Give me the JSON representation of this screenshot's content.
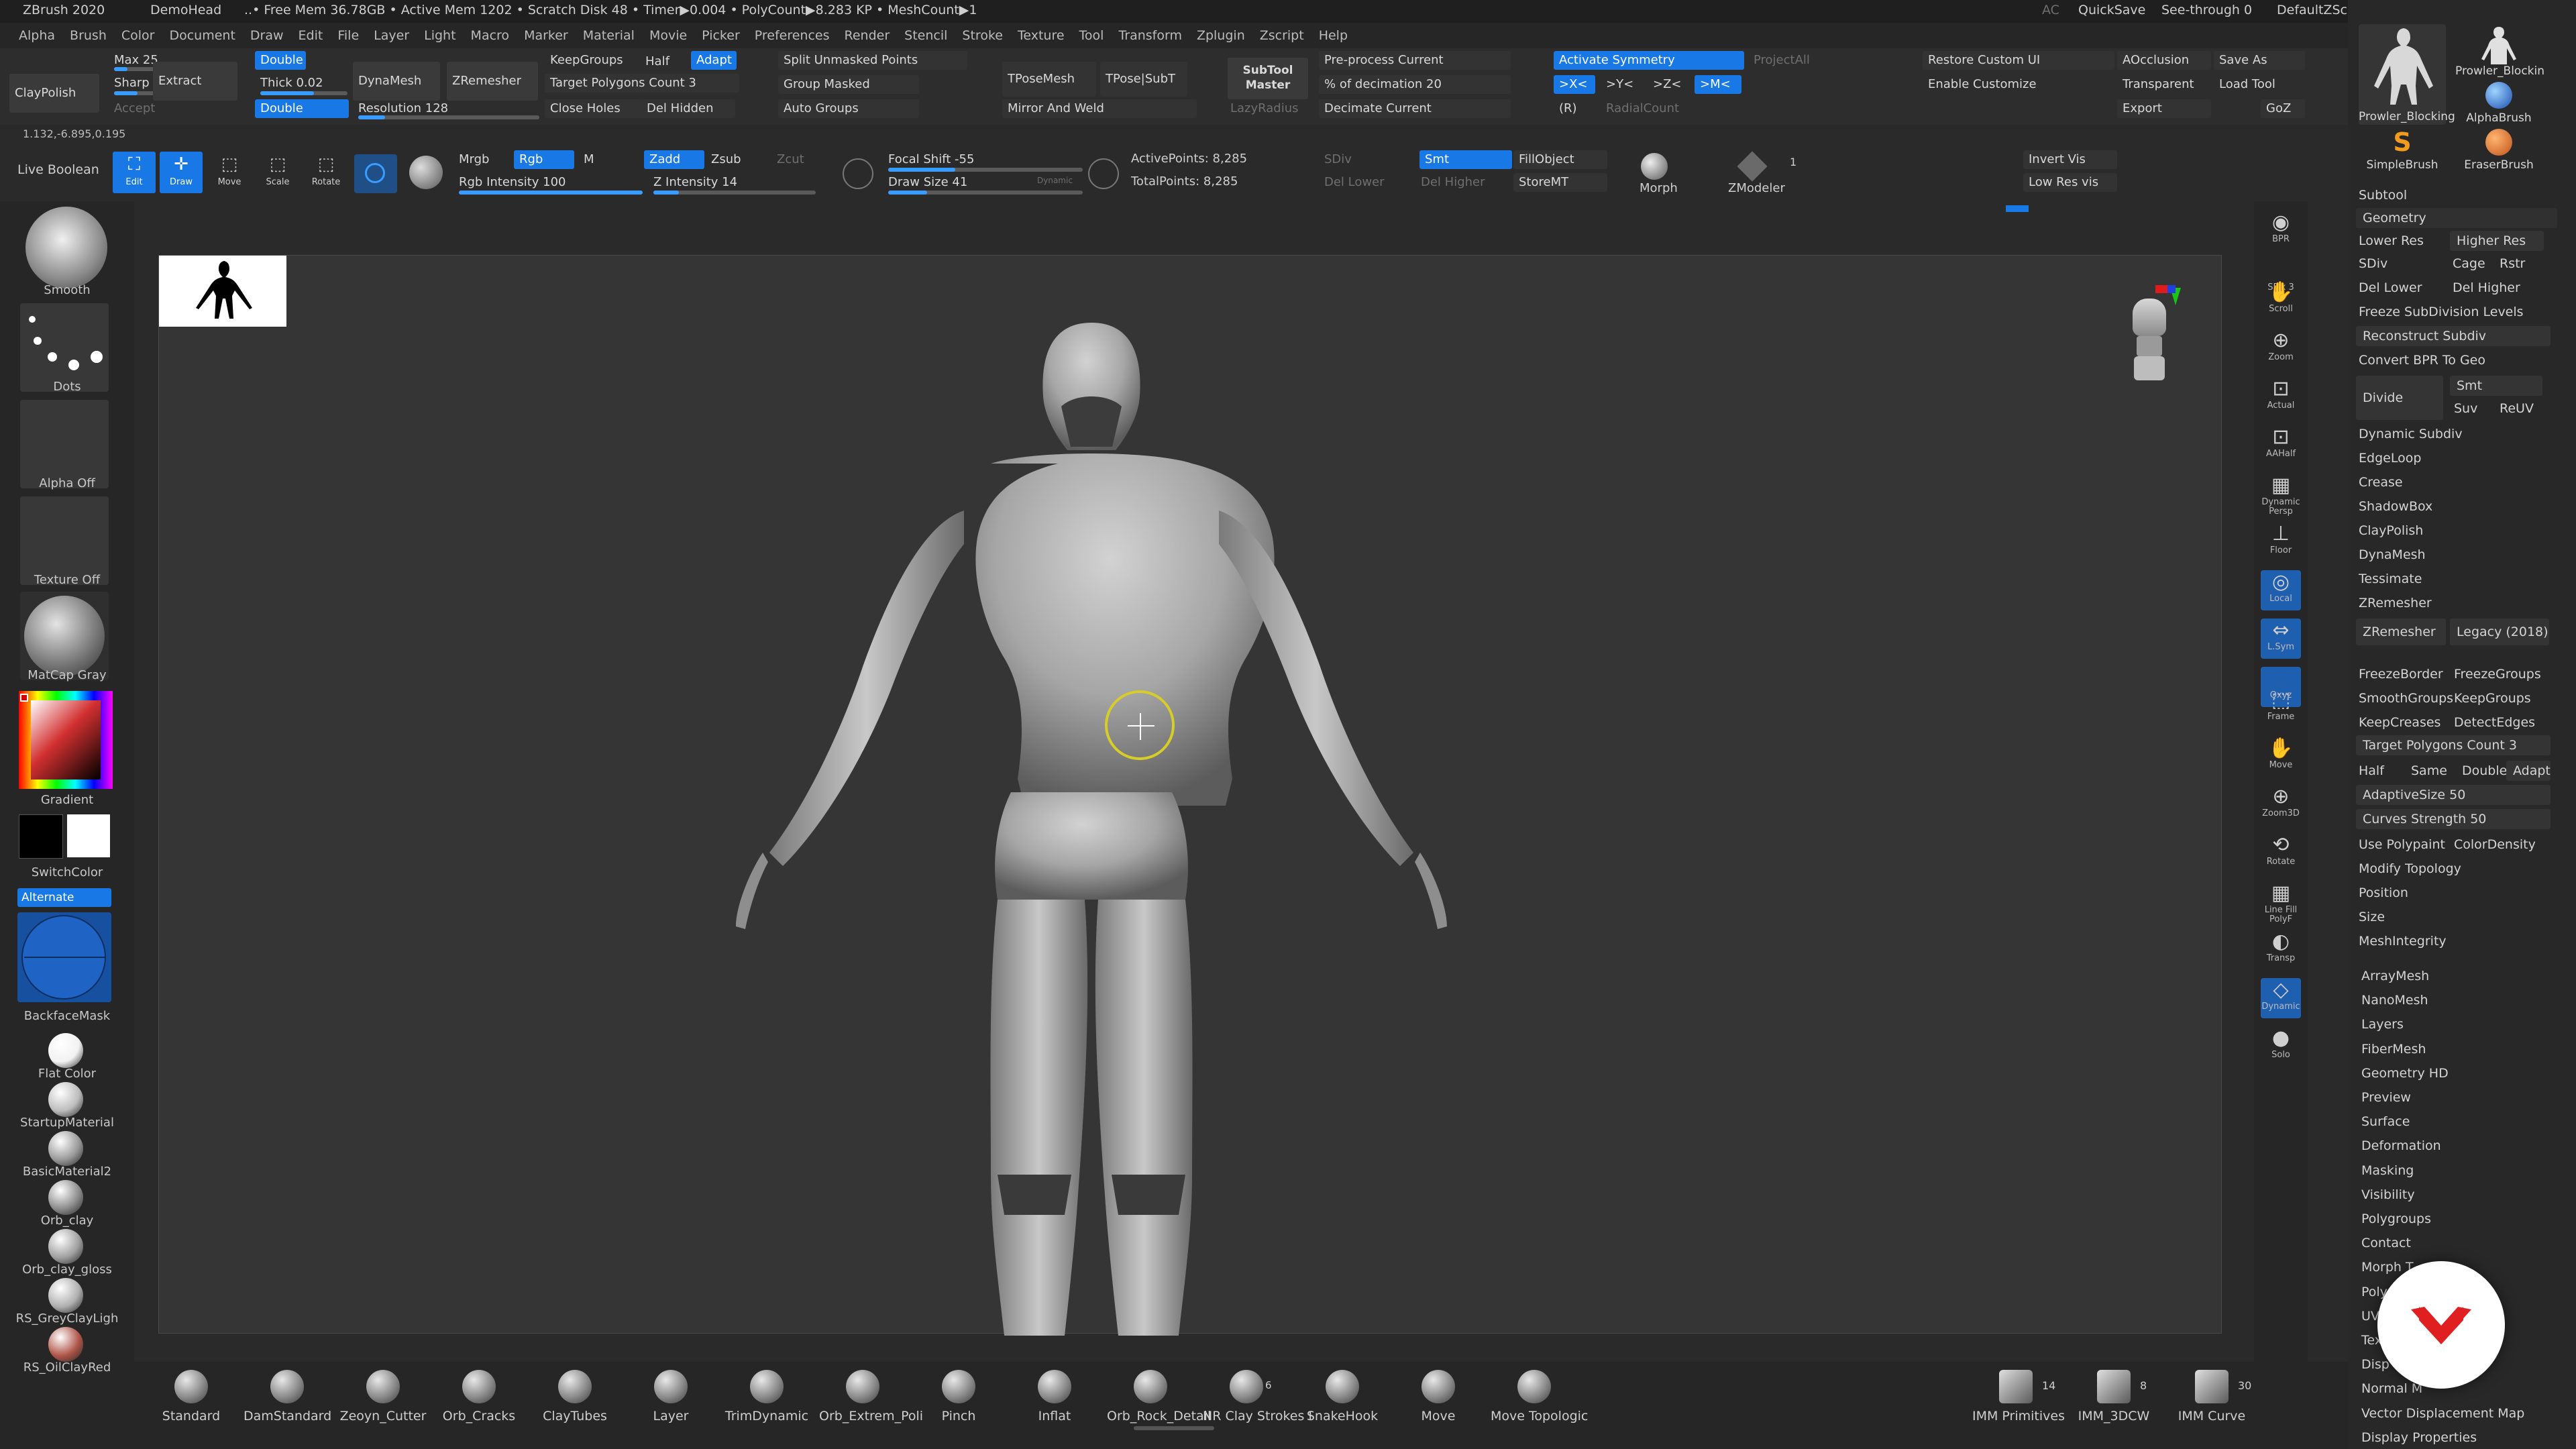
{
  "titlebar": {
    "app": "ZBrush 2020",
    "project": "DemoHead",
    "stats": "..• Free Mem 36.78GB • Active Mem 1202 • Scratch Disk 48 • Timer▶0.004 • PolyCount▶8.283 KP • MeshCount▶1",
    "ac": "AC",
    "quicksave": "QuickSave",
    "see_through": "See-through  0",
    "script": "DefaultZScript"
  },
  "menu": [
    "Alpha",
    "Brush",
    "Color",
    "Document",
    "Draw",
    "Edit",
    "File",
    "Layer",
    "Light",
    "Macro",
    "Marker",
    "Material",
    "Movie",
    "Picker",
    "Preferences",
    "Render",
    "Stencil",
    "Stroke",
    "Texture",
    "Tool",
    "Transform",
    "Zplugin",
    "Zscript",
    "Help"
  ],
  "shelf_row1": {
    "claypolish": "ClayPolish",
    "max": "Max 25",
    "sharp": "Sharp",
    "extract": "Extract",
    "accept": "Accept",
    "double1": "Double",
    "thick": "Thick 0.02",
    "double2": "Double",
    "dynamesh": "DynaMesh",
    "resolution": "Resolution 128",
    "zremesher": "ZRemesher",
    "keepgroups": "KeepGroups",
    "half": "Half",
    "adapt": "Adapt",
    "target_polys": "Target Polygons Count 3",
    "close_holes": "Close Holes",
    "del_hidden": "Del Hidden",
    "split_unmasked": "Split Unmasked Points",
    "group_masked": "Group Masked",
    "auto_groups": "Auto Groups",
    "tposemesh": "TPoseMesh",
    "tpose_subt": "TPose|SubT",
    "mirror_weld": "Mirror And Weld",
    "subtool_master": "SubTool Master",
    "lazyradius": "LazyRadius",
    "preprocess": "Pre-process Current",
    "pct_decimation": "% of decimation 20",
    "decimate_current": "Decimate Current",
    "activate_symmetry": "Activate Symmetry",
    "projectall": "ProjectAll",
    "sym_x": ">X<",
    "sym_y": ">Y<",
    "sym_z": ">Z<",
    "sym_m": ">M<",
    "sym_r": "(R)",
    "radialcount": "RadialCount",
    "restore_ui": "Restore Custom UI",
    "enable_customize": "Enable Customize",
    "aocclusion": "AOcclusion",
    "transparent": "Transparent",
    "export": "Export",
    "save_as": "Save As",
    "load_tool": "Load Tool",
    "goz": "GoZ"
  },
  "shelf_row2": {
    "coords": "1.132,-6.895,0.195",
    "live_boolean": "Live Boolean",
    "edit": "Edit",
    "draw": "Draw",
    "move": "Move",
    "scale": "Scale",
    "rotate": "Rotate",
    "mrgb": "Mrgb",
    "rgb": "Rgb",
    "m": "M",
    "rgb_intensity": "Rgb Intensity 100",
    "zadd": "Zadd",
    "zsub": "Zsub",
    "zcut": "Zcut",
    "z_intensity": "Z Intensity 14",
    "focal_shift": "Focal Shift -55",
    "draw_size": "Draw Size 41",
    "dynamic": "Dynamic",
    "active_points": "ActivePoints: 8,285",
    "total_points": "TotalPoints: 8,285",
    "sdiv": "SDiv",
    "smt": "Smt",
    "del_lower": "Del Lower",
    "del_higher": "Del Higher",
    "fillobject": "FillObject",
    "storemt": "StoreMT",
    "morph": "Morph",
    "zmodeler": "ZModeler",
    "zmodeler_count": "1",
    "invert_vis": "Invert Vis",
    "low_res_vis": "Low Res vis"
  },
  "left_shelf": {
    "brush": "Smooth",
    "stroke": "Dots",
    "alpha": "Alpha Off",
    "texture": "Texture Off",
    "material": "MatCap Gray",
    "gradient": "Gradient",
    "switchcolor": "SwitchColor",
    "alternate": "Alternate",
    "backfacemask": "BackfaceMask",
    "materials": [
      {
        "label": "Flat Color",
        "color": "#f2f2f2"
      },
      {
        "label": "StartupMaterial",
        "color": "#bdbdbd"
      },
      {
        "label": "BasicMaterial2",
        "color": "#9a9a9a"
      },
      {
        "label": "Orb_clay",
        "color": "#8d8d8d"
      },
      {
        "label": "Orb_clay_gloss",
        "color": "#a0a0a0"
      },
      {
        "label": "RS_GreyClayLigh",
        "color": "#b0b0b0"
      },
      {
        "label": "RS_OilClayRed",
        "color": "#b0574a"
      }
    ]
  },
  "right_tools": {
    "bpr": "BPR",
    "spix": "SPix 3",
    "scroll": "Scroll",
    "zoom": "Zoom",
    "actual": "Actual",
    "aahalf": "AAHalf",
    "dynamic_persp": "Dynamic Persp",
    "floor": "Floor",
    "local": "Local",
    "lsym": "L.Sym",
    "xyz": "Qxyz",
    "frame": "Frame",
    "move": "Move",
    "zoom3d": "Zoom3D",
    "rotate": "Rotate",
    "line_fill": "Line Fill PolyF",
    "transp": "Transp",
    "dynamic": "Dynamic",
    "solo": "Solo"
  },
  "palette": {
    "thumbs": [
      "Prowler_Blocking",
      "Prowler_Blockin",
      "AlphaBrush",
      "SimpleBrush",
      "EraserBrush"
    ],
    "subtool": "Subtool",
    "geometry": "Geometry",
    "lower_res": "Lower Res",
    "higher_res": "Higher Res",
    "sdiv": "SDiv",
    "cage": "Cage",
    "rstr": "Rstr",
    "del_lower": "Del Lower",
    "del_higher": "Del Higher",
    "freeze_subdiv": "Freeze SubDivision Levels",
    "reconstruct_subdiv": "Reconstruct Subdiv",
    "convert_bpr": "Convert BPR To Geo",
    "divide": "Divide",
    "smt": "Smt",
    "suv": "Suv",
    "reuv": "ReUV",
    "items_a": [
      "Dynamic Subdiv",
      "EdgeLoop",
      "Crease",
      "ShadowBox",
      "ClayPolish",
      "DynaMesh",
      "Tessimate"
    ],
    "zremesher_header": "ZRemesher",
    "zremesher_btn": "ZRemesher",
    "legacy": "Legacy (2018)",
    "freezeborder": "FreezeBorder",
    "freezegroups": "FreezeGroups",
    "smoothgroups": "SmoothGroups",
    "keepgroups": "KeepGroups",
    "keepcreases": "KeepCreases",
    "detectedges": "DetectEdges",
    "target_polys": "Target Polygons Count 3",
    "half": "Half",
    "same": "Same",
    "double": "Double",
    "adapt": "Adapt",
    "adaptivesize": "AdaptiveSize 50",
    "curves_strength": "Curves Strength 50",
    "use_polypaint": "Use Polypaint",
    "colordensity": "ColorDensity",
    "items_b": [
      "Modify Topology",
      "Position",
      "Size",
      "MeshIntegrity"
    ],
    "items_c": [
      "ArrayMesh",
      "NanoMesh",
      "Layers",
      "FiberMesh",
      "Geometry HD",
      "Preview",
      "Surface",
      "Deformation",
      "Masking",
      "Visibility",
      "Polygroups",
      "Contact",
      "Morph T",
      "Polyp",
      "UV",
      "Tex",
      "Disp",
      "Normal M",
      "Vector Displacement Map",
      "Display Properties"
    ]
  },
  "bottom_brushes": [
    "Standard",
    "DamStandard",
    "Zeoyn_Cutter",
    "Orb_Cracks",
    "ClayTubes",
    "Layer",
    "TrimDynamic",
    "Orb_Extrem_Poli",
    "Pinch",
    "Inflat",
    "Orb_Rock_Detail",
    "NR Clay Strokes I",
    "SnakeHook",
    "Move",
    "Move Topologic"
  ],
  "bottom_counts": {
    "clay_strokes": "6"
  },
  "bottom_right": [
    {
      "label": "IMM Primitives",
      "count": "14"
    },
    {
      "label": "IMM_3DCW",
      "count": "8"
    },
    {
      "label": "IMM Curve",
      "count": "30"
    }
  ]
}
